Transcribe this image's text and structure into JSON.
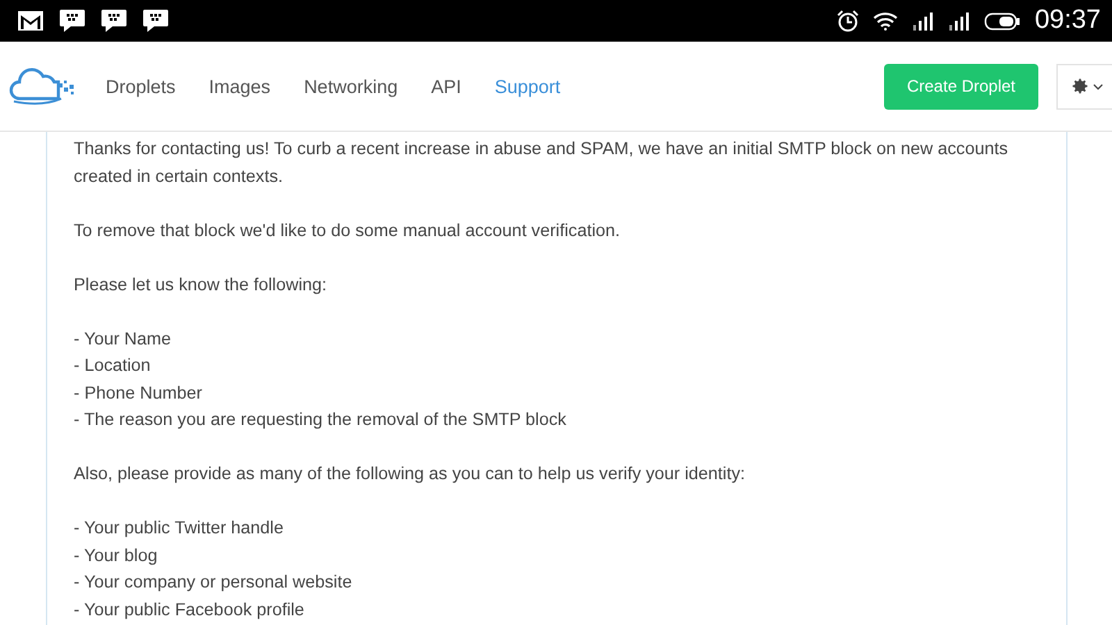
{
  "status_bar": {
    "time": "09:37"
  },
  "nav": {
    "items": [
      {
        "label": "Droplets",
        "selected": false
      },
      {
        "label": "Images",
        "selected": false
      },
      {
        "label": "Networking",
        "selected": false
      },
      {
        "label": "API",
        "selected": false
      },
      {
        "label": "Support",
        "selected": true
      }
    ],
    "create_button": "Create Droplet"
  },
  "message": {
    "blocks": [
      {
        "kind": "paragraph",
        "text": "Thanks for contacting us! To curb a recent increase in abuse and SPAM, we have an initial SMTP block on new accounts created in certain contexts."
      },
      {
        "kind": "paragraph",
        "text": "To remove that block we'd like to do some manual account verification."
      },
      {
        "kind": "paragraph",
        "text": "Please let us know the following:"
      },
      {
        "kind": "list",
        "items": [
          "- Your Name",
          "- Location",
          "- Phone Number",
          "- The reason you are requesting the removal of the SMTP block"
        ]
      },
      {
        "kind": "paragraph",
        "text": "Also, please provide as many of the following as you can to help us verify your identity:"
      },
      {
        "kind": "list",
        "items": [
          "- Your public Twitter handle",
          "- Your blog",
          "- Your company or personal website",
          "- Your public Facebook profile"
        ]
      }
    ]
  }
}
